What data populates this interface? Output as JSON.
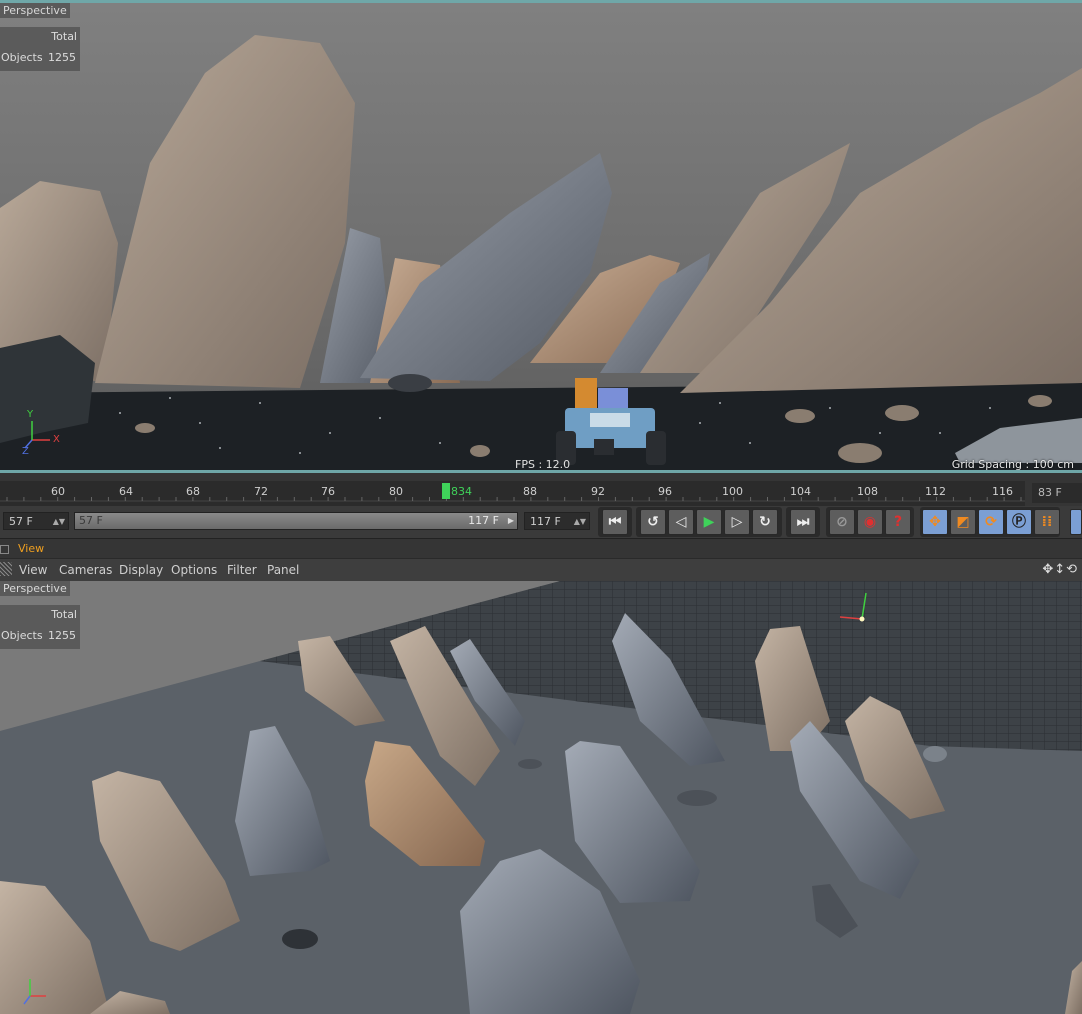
{
  "top_viewport": {
    "label": "Perspective",
    "hud": {
      "total_label": "Total",
      "objects_label": "Objects",
      "objects_value": "1255"
    },
    "fps": "FPS : 12.0",
    "grid_spacing": "Grid Spacing : 100 cm",
    "axis": {
      "x": "X",
      "y": "Y",
      "z": "Z"
    }
  },
  "timeline": {
    "ticks": [
      "60",
      "64",
      "68",
      "72",
      "76",
      "80",
      "834",
      "88",
      "92",
      "96",
      "100",
      "104",
      "108",
      "112",
      "116"
    ],
    "current_frame": "834",
    "end_field": "83 F"
  },
  "transport": {
    "start_field": "57 F",
    "range_start": "57 F",
    "range_end": "117 F",
    "end_field": "117 F"
  },
  "view_panel": {
    "title": "View",
    "menus": [
      "View",
      "Cameras",
      "Display",
      "Options",
      "Filter",
      "Panel"
    ],
    "nav_icons": "✥↕⟲"
  },
  "bottom_viewport": {
    "label": "Perspective",
    "hud": {
      "total_label": "Total",
      "objects_label": "Objects",
      "objects_value": "1255"
    }
  },
  "colors": {
    "accent": "#6fa7a8",
    "view_label": "#f0a020",
    "play": "#3fd25a",
    "active_tool": "#7b9fd4"
  }
}
